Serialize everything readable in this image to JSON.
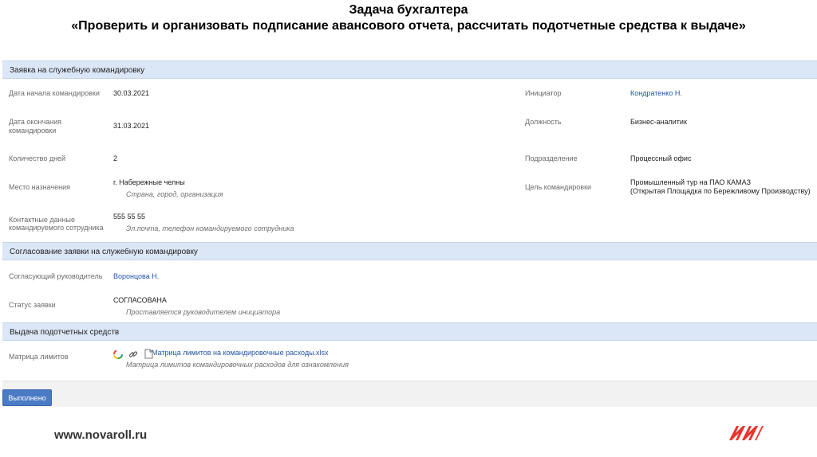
{
  "header": {
    "line1": "Задача бухгалтера",
    "line2": "«Проверить и организовать подписание авансового отчета, рассчитать подотчетные средства к выдаче»"
  },
  "sections": {
    "trip_request": "Заявка на служебную командировку",
    "approval": "Согласование заявки на служебную командировку",
    "funds": "Выдача подотчетных средств"
  },
  "trip": {
    "start_label": "Дата начала командировки",
    "start_value": "30.03.2021",
    "end_label_1": "Дата окончания",
    "end_label_2": "командировки",
    "end_value": "31.03.2021",
    "days_label": "Количество дней",
    "days_value": "2",
    "destination_label": "Место назначения",
    "destination_value": "г. Набережные челны",
    "destination_hint": "Страна, город, организация",
    "contact_label_1": "Контактные данные",
    "contact_label_2": "командируемого сотрудника",
    "contact_value": "555 55 55",
    "contact_hint": "Эл.почта, телефон командируемого сотрудника",
    "initiator_label": "Инициатор",
    "initiator_value": "Кондратенко Н.",
    "position_label": "Должность",
    "position_value": "Бизнес-аналитик",
    "department_label": "Подразделение",
    "department_value": "Процессный офис",
    "purpose_label": "Цель командировки",
    "purpose_line1": "Промышленный тур на ПАО КАМАЗ",
    "purpose_line2": "(Открытая Площадка по Бережливому Производству)"
  },
  "approval": {
    "manager_label": "Согласующий руководитель",
    "manager_value": "Воронцова Н.",
    "status_label": "Статус заявки",
    "status_value": "СОГЛАСОВАНА",
    "status_hint": "Проставляется руководителем инициатора"
  },
  "funds": {
    "matrix_label": "Матрица лимитов",
    "file_name": "Матрица лимитов на командировочные расходы.xlsx",
    "file_hint": "Матрица лимитов командировочных расходов для ознакомления",
    "icons": [
      "google-drive-icon",
      "link-icon",
      "document-icon"
    ]
  },
  "actions": {
    "done": "Выполнено"
  },
  "footer": {
    "url": "www.novaroll.ru",
    "logo_color": "#e8332c"
  },
  "colors": {
    "section_bg": "#dbe7f6",
    "link": "#2355a6",
    "button": "#4b7bc4"
  }
}
